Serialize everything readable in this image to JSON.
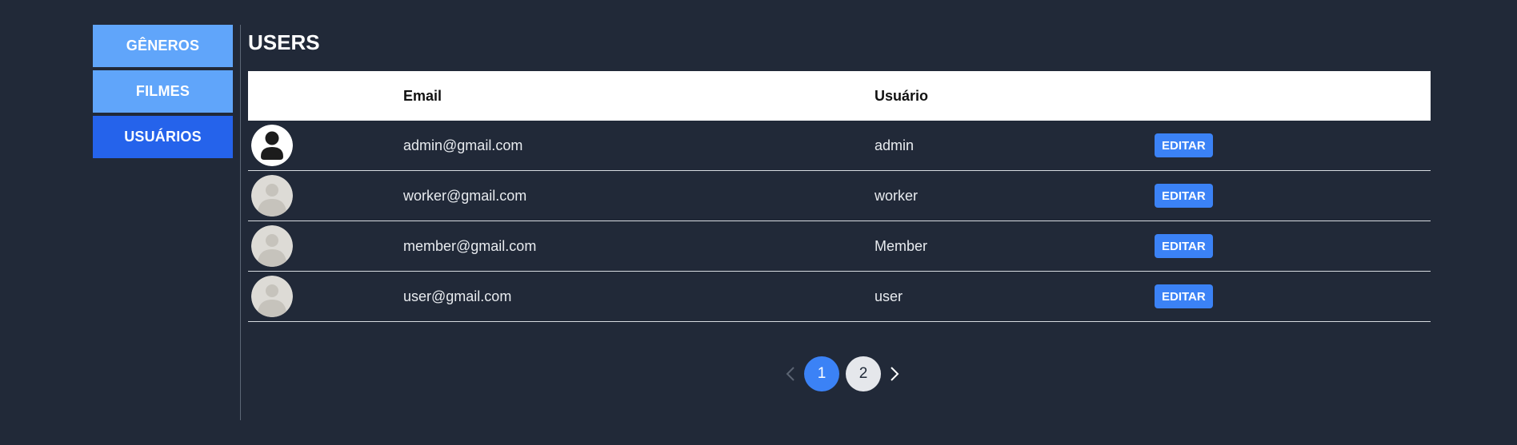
{
  "sidebar": {
    "items": [
      {
        "label": "GÊNEROS",
        "active": false
      },
      {
        "label": "FILMES",
        "active": false
      },
      {
        "label": "USUÁRIOS",
        "active": true
      }
    ]
  },
  "main": {
    "title": "USERS",
    "table": {
      "headers": [
        "",
        "Email",
        "Usuário",
        ""
      ],
      "rows": [
        {
          "avatar": "admin-avatar-icon",
          "email": "admin@gmail.com",
          "username": "admin",
          "action": "EDITAR"
        },
        {
          "avatar": "default-avatar-icon",
          "email": "worker@gmail.com",
          "username": "worker",
          "action": "EDITAR"
        },
        {
          "avatar": "default-avatar-icon",
          "email": "member@gmail.com",
          "username": "Member",
          "action": "EDITAR"
        },
        {
          "avatar": "default-avatar-icon",
          "email": "user@gmail.com",
          "username": "user",
          "action": "EDITAR"
        }
      ]
    },
    "pagination": {
      "pages": [
        "1",
        "2"
      ],
      "current": "1"
    }
  },
  "colors": {
    "background": "#212938",
    "sidebar_item": "#60a5fa",
    "sidebar_active": "#2563eb",
    "accent": "#3b82f6"
  }
}
